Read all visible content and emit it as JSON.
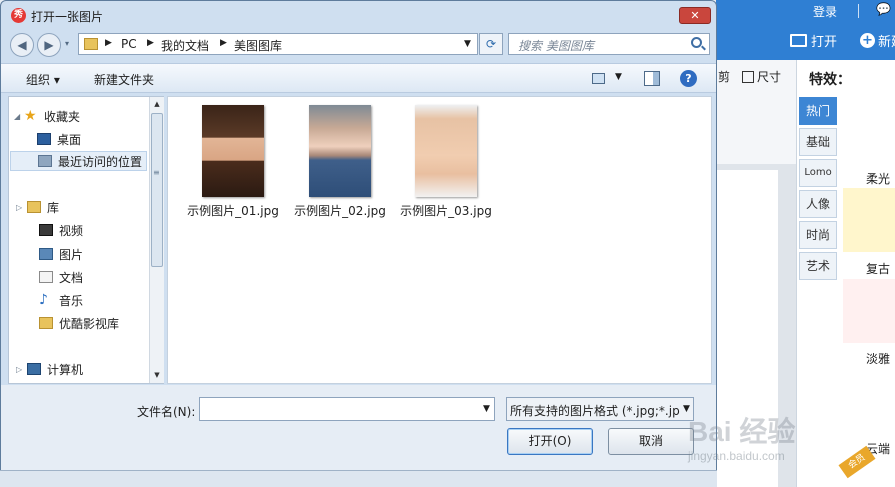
{
  "dialog": {
    "title": "打开一张图片",
    "close": "✕",
    "nav": {
      "back": "◀",
      "forward": "▶",
      "recent": "▾"
    },
    "address": {
      "segments": [
        "PC",
        "我的文档",
        "美图图库"
      ]
    },
    "search_placeholder": "搜索 美图图库",
    "toolbar": {
      "organize": "组织 ▾",
      "new_folder": "新建文件夹",
      "help": "?"
    },
    "nav_pane": {
      "items": [
        {
          "label": "收藏夹",
          "icon": "star-icon"
        },
        {
          "label": "桌面",
          "icon": "desktop-icon"
        },
        {
          "label": "最近访问的位置",
          "icon": "recent-places-icon"
        },
        {
          "label": "库",
          "icon": "library-icon"
        },
        {
          "label": "视频",
          "icon": "video-icon"
        },
        {
          "label": "图片",
          "icon": "pictures-icon"
        },
        {
          "label": "文档",
          "icon": "documents-icon"
        },
        {
          "label": "音乐",
          "icon": "music-icon"
        },
        {
          "label": "优酷影视库",
          "icon": "folder-icon"
        },
        {
          "label": "计算机",
          "icon": "computer-icon"
        }
      ]
    },
    "files": [
      {
        "name": "示例图片_01.jpg"
      },
      {
        "name": "示例图片_02.jpg"
      },
      {
        "name": "示例图片_03.jpg"
      }
    ],
    "filename_label": "文件名(N):",
    "filename_value": "",
    "filetype": "所有支持的图片格式 (*.jpg;*.jp",
    "open_button": "打开(O)",
    "cancel_button": "取消"
  },
  "app": {
    "login": "登录",
    "open": "打开",
    "new": "新建",
    "crop": "剪",
    "size": "尺寸",
    "effects_title": "特效：",
    "categories": [
      "热门",
      "基础",
      "Lomo",
      "人像",
      "时尚",
      "艺术"
    ],
    "effects": [
      "柔光",
      "复古",
      "淡雅",
      "云端"
    ],
    "vip": "会员",
    "colors": {
      "accent": "#2f7fd3",
      "swatch1": "#fff6cc",
      "swatch2": "#fff0f0"
    }
  },
  "watermark": {
    "main": "Bai 经验",
    "sub": "jingyan.baidu.com"
  }
}
